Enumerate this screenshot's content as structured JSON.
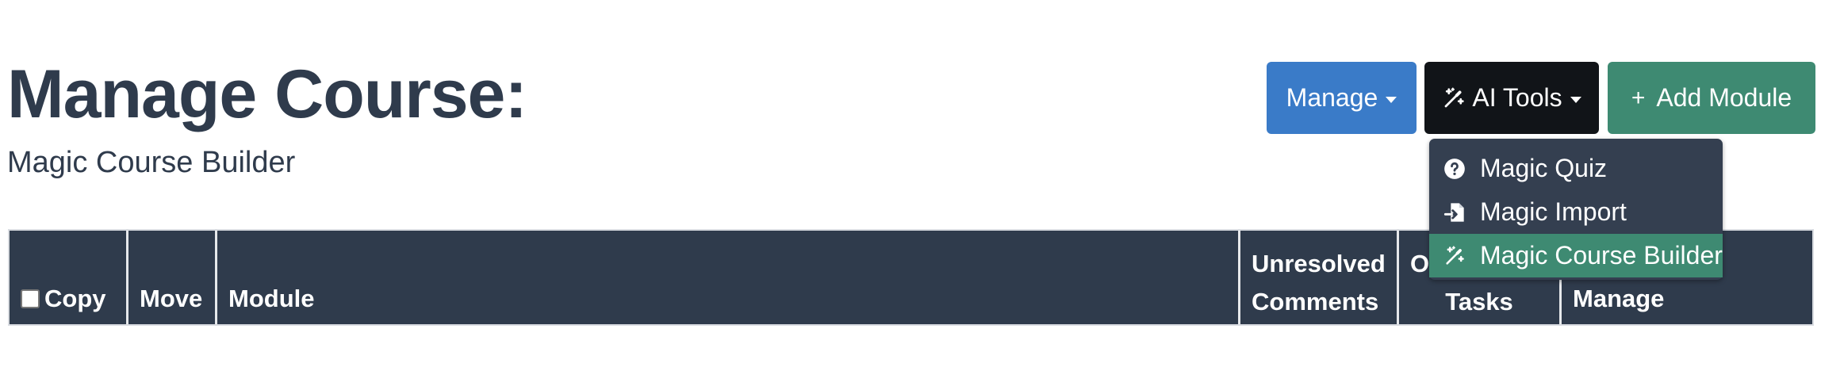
{
  "header": {
    "title": "Manage Course:",
    "subtitle": "Magic Course Builder"
  },
  "toolbar": {
    "manage_label": "Manage",
    "ai_tools_label": "AI Tools",
    "add_module_label": "Add Module",
    "add_module_icon": "plus-icon",
    "colors": {
      "manage": "#3a7bc8",
      "ai_tools": "#111418",
      "add_module": "#3e8a72"
    }
  },
  "ai_menu": {
    "items": [
      {
        "label": "Magic Quiz",
        "icon": "question-circle-icon"
      },
      {
        "label": "Magic Import",
        "icon": "file-import-icon"
      },
      {
        "label": "Magic Course Builder",
        "icon": "magic-wand-icon",
        "active": true
      }
    ],
    "active_color": "#3e8a72"
  },
  "table": {
    "columns": {
      "copy": "Copy",
      "move": "Move",
      "module": "Module",
      "unresolved_line1": "Unresolved",
      "unresolved_line2": "Comments",
      "tasks_line1": "Ou",
      "tasks_line2": "Tasks",
      "manage": "Manage"
    },
    "header_color": "#2f3b4c"
  }
}
